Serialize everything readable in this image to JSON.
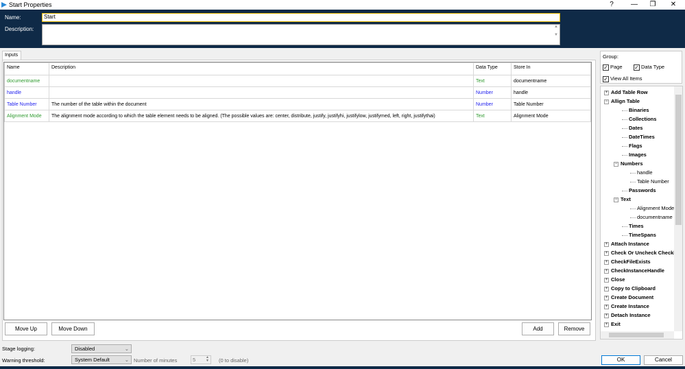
{
  "window": {
    "title": "Start Properties",
    "help": "?",
    "minimize": "—",
    "maximize": "❐",
    "close": "✕"
  },
  "header": {
    "name_label": "Name:",
    "name_value": "Start",
    "description_label": "Description:",
    "description_value": ""
  },
  "tabs": [
    {
      "label": "Inputs"
    }
  ],
  "table": {
    "columns": [
      "Name",
      "Description",
      "Data Type",
      "Store In"
    ],
    "rows": [
      {
        "name": "documentname",
        "description": "",
        "data_type": "Text",
        "store_in": "documentname",
        "color": "#2e9a2e"
      },
      {
        "name": "handle",
        "description": "",
        "data_type": "Number",
        "store_in": "handle",
        "color": "#2222ee"
      },
      {
        "name": "Table Number",
        "description": "The number of the table within the document",
        "data_type": "Number",
        "store_in": "Table Number",
        "color": "#2222ee"
      },
      {
        "name": "Alignment Mode",
        "description": "The alignment mode according to which the table element needs to be aligned. (The possible values are: center, distribute, justify, justifyhi, justifylow, justifymed, left, right, justifythai)",
        "data_type": "Text",
        "store_in": "Alignment Mode",
        "color": "#2e9a2e"
      }
    ]
  },
  "buttons": {
    "move_up": "Move Up",
    "move_down": "Move Down",
    "add": "Add",
    "remove": "Remove",
    "ok": "OK",
    "cancel": "Cancel"
  },
  "group": {
    "label": "Group:",
    "page": "Page",
    "data_type": "Data Type",
    "view_all": "View All Items",
    "check": "✓"
  },
  "tree": [
    {
      "label": "Add Table Row",
      "level": 0,
      "exp": "+"
    },
    {
      "label": "Allign Table",
      "level": 0,
      "exp": "−"
    },
    {
      "label": "Binaries",
      "level": 1
    },
    {
      "label": "Collections",
      "level": 1
    },
    {
      "label": "Dates",
      "level": 1
    },
    {
      "label": "DateTimes",
      "level": 1
    },
    {
      "label": "Flags",
      "level": 1
    },
    {
      "label": "Images",
      "level": 1
    },
    {
      "label": "Numbers",
      "level": 1,
      "exp": "−"
    },
    {
      "label": "handle",
      "level": 2,
      "leaf": true
    },
    {
      "label": "Table Number",
      "level": 2,
      "leaf": true
    },
    {
      "label": "Passwords",
      "level": 1
    },
    {
      "label": "Text",
      "level": 1,
      "exp": "−"
    },
    {
      "label": "Alignment Mode",
      "level": 2,
      "leaf": true
    },
    {
      "label": "documentname",
      "level": 2,
      "leaf": true
    },
    {
      "label": "Times",
      "level": 1
    },
    {
      "label": "TimeSpans",
      "level": 1
    },
    {
      "label": "Attach Instance",
      "level": 0,
      "exp": "+"
    },
    {
      "label": "Check Or Uncheck Checkbo",
      "level": 0,
      "exp": "+"
    },
    {
      "label": "CheckFileExists",
      "level": 0,
      "exp": "+"
    },
    {
      "label": "CheckInstanceHandle",
      "level": 0,
      "exp": "+"
    },
    {
      "label": "Close",
      "level": 0,
      "exp": "+"
    },
    {
      "label": "Copy to Clipboard",
      "level": 0,
      "exp": "+"
    },
    {
      "label": "Create Document",
      "level": 0,
      "exp": "+"
    },
    {
      "label": "Create Instance",
      "level": 0,
      "exp": "+"
    },
    {
      "label": "Detach Instance",
      "level": 0,
      "exp": "+"
    },
    {
      "label": "Exit",
      "level": 0,
      "exp": "+"
    }
  ],
  "footer": {
    "stage_logging_label": "Stage logging:",
    "stage_logging_value": "Disabled",
    "warning_label": "Warning threshold:",
    "warning_value": "System Default",
    "minutes_label": "Number of minutes",
    "minutes_value": "5",
    "disable_hint": "(0 to disable)"
  }
}
